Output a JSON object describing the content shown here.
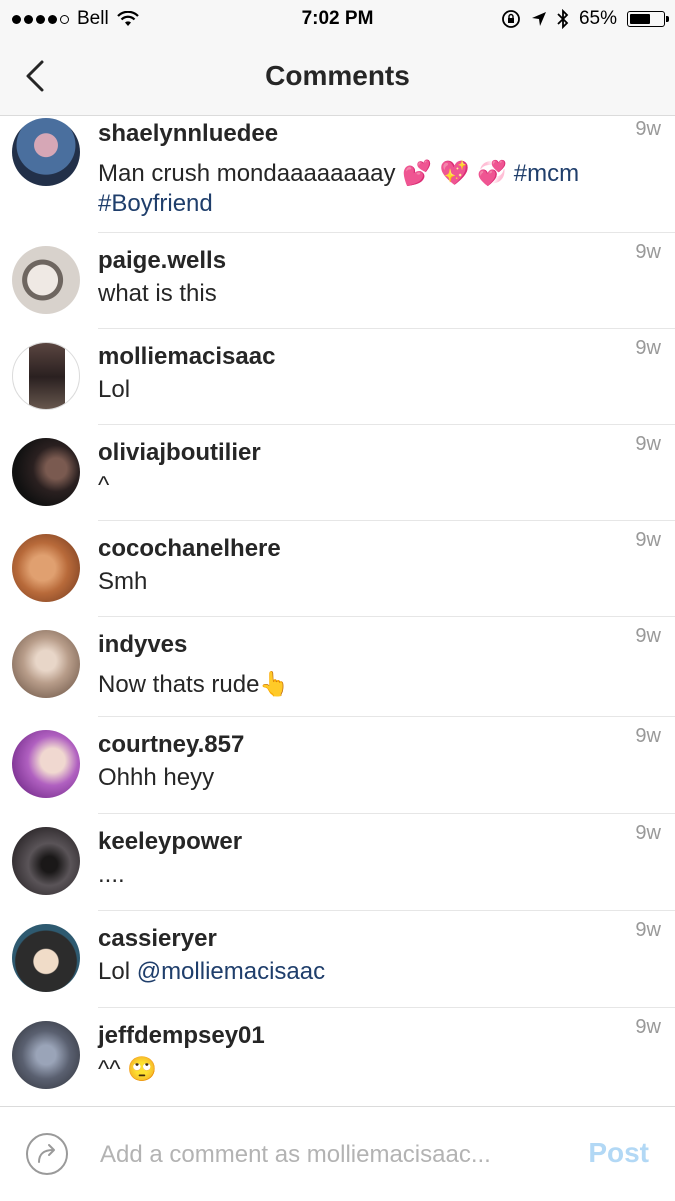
{
  "status_bar": {
    "carrier": "Bell",
    "time": "7:02 PM",
    "battery": "65%",
    "battery_level": 0.65,
    "icons": [
      "signal-dots",
      "wifi-icon",
      "orientation-lock-icon",
      "location-arrow-icon",
      "bluetooth-icon",
      "battery-icon"
    ]
  },
  "nav": {
    "title": "Comments",
    "back_icon": "chevron-left-icon"
  },
  "comments": [
    {
      "username": "shaelynnluedee",
      "time": "9w",
      "text_before": "Man crush mondaaaaaaaay ",
      "emoji": "💕 💖 💞",
      "tag1": "#mcm",
      "tag2": "#Boyfriend",
      "avatar_color": "#2e3a55"
    },
    {
      "username": "paige.wells",
      "time": "9w",
      "text": "what is this",
      "avatar_color": "#d8d2cc"
    },
    {
      "username": "molliemacisaac",
      "time": "9w",
      "text": "Lol",
      "avatar_color": "#3a3030"
    },
    {
      "username": "oliviajboutilier",
      "time": "9w",
      "text": "^",
      "avatar_color": "#1e1a1a"
    },
    {
      "username": "cocochanelhere",
      "time": "9w",
      "text": "Smh",
      "avatar_color": "#c98050"
    },
    {
      "username": "indyves",
      "time": "9w",
      "text": "Now thats rude",
      "emoji": "👆",
      "avatar_color": "#b89d8a"
    },
    {
      "username": "courtney.857",
      "time": "9w",
      "text": "Ohhh heyy",
      "avatar_color": "#a050b0"
    },
    {
      "username": "keeleypower",
      "time": "9w",
      "text": "....",
      "avatar_color": "#3a3538"
    },
    {
      "username": "cassieryer",
      "time": "9w",
      "text": "Lol ",
      "mention": "@molliemacisaac",
      "avatar_color": "#2c2c2c"
    },
    {
      "username": "jeffdempsey01",
      "time": "9w",
      "text": "^^ ",
      "emoji": "🙄",
      "avatar_color": "#5a6070"
    }
  ],
  "composer": {
    "placeholder": "Add a comment as molliemacisaac...",
    "value": "",
    "post_label": "Post",
    "post_color": "#b2d8f5",
    "reply_icon": "reply-arrow-icon"
  }
}
